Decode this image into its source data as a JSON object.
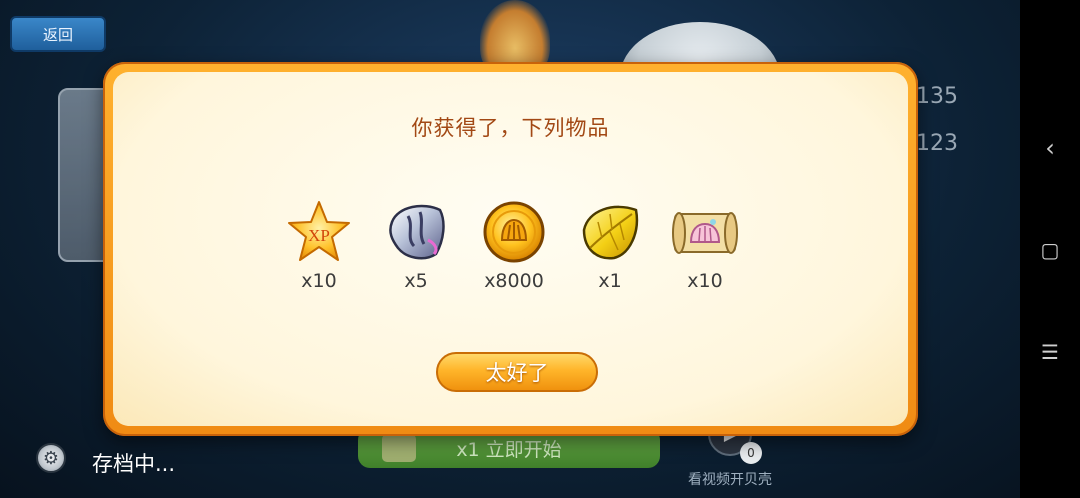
{
  "header": {
    "back_label": "返回"
  },
  "background": {
    "side_numbers": [
      "135",
      "123"
    ],
    "start_button_label": "x1 立即开始",
    "video_badge": "0",
    "video_label": "看视频开贝壳",
    "saving_label": "存档中..."
  },
  "dialog": {
    "title": "你获得了，下列物品",
    "items": [
      {
        "icon": "xp-star-icon",
        "quantity": "x10",
        "badge": "XP"
      },
      {
        "icon": "shell-gem-icon",
        "quantity": "x5"
      },
      {
        "icon": "gold-coin-icon",
        "quantity": "x8000"
      },
      {
        "icon": "golden-leaf-icon",
        "quantity": "x1"
      },
      {
        "icon": "treasure-map-icon",
        "quantity": "x10"
      }
    ],
    "confirm_label": "太好了"
  },
  "colors": {
    "accent_orange": "#f5a01c",
    "title_brown": "#a24814"
  }
}
